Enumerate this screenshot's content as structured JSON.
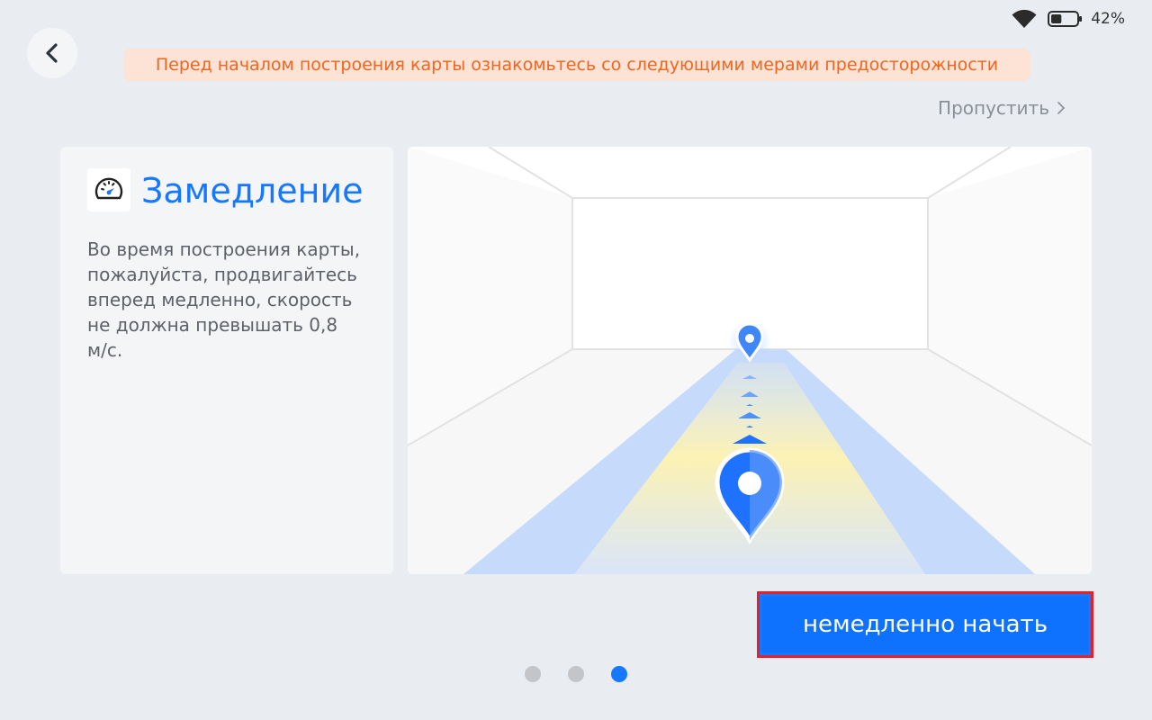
{
  "status_bar": {
    "wifi_icon": "wifi-icon",
    "battery_icon": "battery-icon",
    "battery_level": 42,
    "battery_text": "42%"
  },
  "back_button": {
    "icon": "chevron-left-icon"
  },
  "warning_banner": {
    "text": "Перед началом построения карты ознакомьтесь со следующими мерами предосторожности",
    "text_color": "#f0651f",
    "background": "#fde3d6"
  },
  "skip": {
    "label": "Пропустить",
    "icon": "chevron-right-icon"
  },
  "card": {
    "icon": "speedometer-icon",
    "title": "Замедление",
    "description": "Во время построения карты, пожалуйста, продвигайтесь вперед медленно, скорость не должна превышать 0,8 м/с."
  },
  "illustration": {
    "icons": [
      "location-pin-icon",
      "location-pin-icon"
    ]
  },
  "start_button": {
    "label": "немедленно начать",
    "color": "#1677ff"
  },
  "pagination": {
    "total": 3,
    "active": 3
  }
}
